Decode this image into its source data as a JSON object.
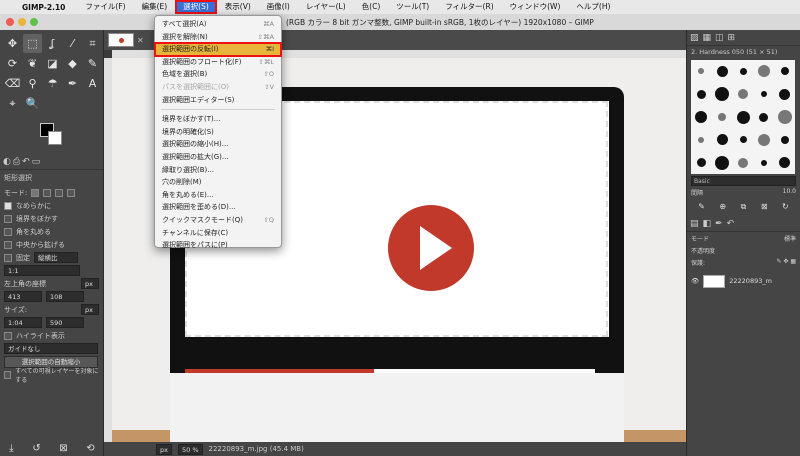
{
  "menubar": {
    "apple": "",
    "app_name": "GIMP-2.10",
    "items": [
      "ファイル(F)",
      "編集(E)",
      "選択(S)",
      "表示(V)",
      "画像(I)",
      "レイヤー(L)",
      "色(C)",
      "ツール(T)",
      "フィルター(R)",
      "ウィンドウ(W)",
      "ヘルプ(H)"
    ],
    "active_index": 2
  },
  "window": {
    "title": "(RGB カラー 8 bit ガンマ整数, GIMP built-in sRGB, 1枚のレイヤー) 1920x1080 – GIMP"
  },
  "select_menu": {
    "items": [
      {
        "label": "すべて選択(A)",
        "shortcut": "⌘A"
      },
      {
        "label": "選択を解除(N)",
        "shortcut": "⇧⌘A"
      },
      {
        "label": "選択範囲の反転(I)",
        "shortcut": "⌘I",
        "highlighted": true
      },
      {
        "label": "選択範囲のフロート化(F)",
        "shortcut": "⇧⌘L"
      },
      {
        "label": "色域を選択(B)",
        "shortcut": "⇧O"
      },
      {
        "label": "パスを選択範囲に(O)",
        "shortcut": "⇧V",
        "disabled": true
      },
      {
        "label": "選択範囲エディター(S)",
        "shortcut": ""
      },
      {
        "separator": true
      },
      {
        "label": "境界をぼかす(T)...",
        "shortcut": ""
      },
      {
        "label": "境界の明確化(S)",
        "shortcut": ""
      },
      {
        "label": "選択範囲の縮小(H)...",
        "shortcut": ""
      },
      {
        "label": "選択範囲の拡大(G)...",
        "shortcut": ""
      },
      {
        "label": "縁取り選択(B)...",
        "shortcut": ""
      },
      {
        "label": "穴の削除(M)",
        "shortcut": ""
      },
      {
        "label": "角を丸める(E)...",
        "shortcut": ""
      },
      {
        "label": "選択範囲を歪める(D)...",
        "shortcut": ""
      },
      {
        "label": "クイックマスクモード(Q)",
        "shortcut": "⇧Q"
      },
      {
        "label": "チャンネルに保存(C)",
        "shortcut": ""
      },
      {
        "label": "選択範囲をパスに(P)",
        "shortcut": ""
      }
    ]
  },
  "toolbox": {
    "tools": [
      {
        "icon": "move-icon",
        "glyph": "✥"
      },
      {
        "icon": "rect-select-icon",
        "glyph": "⬚",
        "selected": true
      },
      {
        "icon": "lasso-icon",
        "glyph": "ʆ"
      },
      {
        "icon": "fuzzy-select-icon",
        "glyph": "⁄"
      },
      {
        "icon": "crop-icon",
        "glyph": "⌗"
      },
      {
        "icon": "unified-transform-icon",
        "glyph": "⟳"
      },
      {
        "icon": "warp-icon",
        "glyph": "❦"
      },
      {
        "icon": "cage-icon",
        "glyph": "◪"
      },
      {
        "icon": "bucket-fill-icon",
        "glyph": "◆"
      },
      {
        "icon": "paintbrush-icon",
        "glyph": "✎"
      },
      {
        "icon": "eraser-icon",
        "glyph": "⌫"
      },
      {
        "icon": "clone-icon",
        "glyph": "⚲"
      },
      {
        "icon": "smudge-icon",
        "glyph": "☂"
      },
      {
        "icon": "paths-icon",
        "glyph": "✒"
      },
      {
        "icon": "text-icon",
        "glyph": "A"
      },
      {
        "icon": "color-picker-icon",
        "glyph": "⌖"
      },
      {
        "icon": "zoom-icon",
        "glyph": "🔍"
      }
    ],
    "options_title": "矩形選択",
    "mode_label": "モード:",
    "options": [
      {
        "label": "なめらかに",
        "checked": true
      },
      {
        "label": "境界をぼかす",
        "checked": false
      },
      {
        "label": "角を丸める",
        "checked": false
      },
      {
        "label": "中央から拡げる",
        "checked": false
      }
    ],
    "fixed_label": "固定",
    "fixed_value": "縦横比",
    "ratio_value": "1:1",
    "position_label": "左上角の座標",
    "position_x": "413",
    "position_y": "108",
    "unit": "px",
    "size_label": "サイズ:",
    "size_w": "1:04",
    "size_h": "590",
    "highlight_label": "ハイライト表示",
    "guides_value": "ガイドなし",
    "auto_shrink_button": "選択範囲の自動縮小",
    "merged_label": "すべての可視レイヤーを対象にする"
  },
  "image_tab": {
    "close": "✕"
  },
  "status": {
    "unit": "px",
    "zoom": "50 %",
    "filename": "22220893_m.jpg (45.4 MB)"
  },
  "image": {
    "progress_fraction": 0.46
  },
  "dock": {
    "tab_icons": [
      "▨",
      "▦",
      "◫",
      "⊞"
    ],
    "brush_name": "2. Hardness 050 (51 × 51)",
    "filter_placeholder": "Basic",
    "spacing_label": "間隔",
    "spacing_value": "10.0",
    "layers_mode_label": "モード",
    "layers_mode_value": "標準",
    "opacity_label": "不透明度",
    "lock_label": "保護:",
    "layer_name": "22220893_m"
  },
  "colors": {
    "accent": "#3a6fd8",
    "highlight": "#e8b53a",
    "annotation": "#e11111",
    "play": "#c0392b"
  }
}
